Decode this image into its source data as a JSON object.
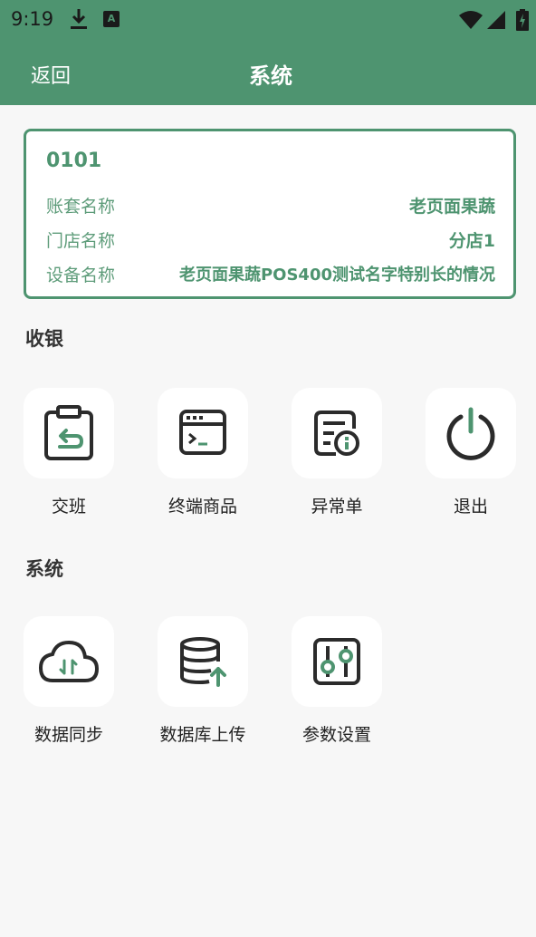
{
  "status_bar": {
    "time": "9:19",
    "icons": [
      "download-icon",
      "a-notification-icon",
      "wifi-icon",
      "cell-signal-icon",
      "battery-charging-icon"
    ],
    "a_icon_text": "A"
  },
  "app_bar": {
    "back_label": "返回",
    "title": "系统"
  },
  "info_card": {
    "code": "0101",
    "rows": [
      {
        "label": "账套名称",
        "value": "老页面果蔬"
      },
      {
        "label": "门店名称",
        "value": "分店1"
      },
      {
        "label": "设备名称",
        "value": "老页面果蔬POS400测试名字特别长的情况"
      }
    ]
  },
  "sections": [
    {
      "title": "收银",
      "items": [
        {
          "label": "交班",
          "icon": "handover-clipboard-icon"
        },
        {
          "label": "终端商品",
          "icon": "terminal-window-icon"
        },
        {
          "label": "异常单",
          "icon": "exception-document-icon"
        },
        {
          "label": "退出",
          "icon": "power-icon"
        }
      ]
    },
    {
      "title": "系统",
      "items": [
        {
          "label": "数据同步",
          "icon": "cloud-sync-icon"
        },
        {
          "label": "数据库上传",
          "icon": "database-upload-icon"
        },
        {
          "label": "参数设置",
          "icon": "settings-sliders-icon"
        }
      ]
    }
  ],
  "colors": {
    "brand": "#4e9470",
    "background": "#f7f7f7",
    "icon_dark": "#2b2b2b"
  }
}
